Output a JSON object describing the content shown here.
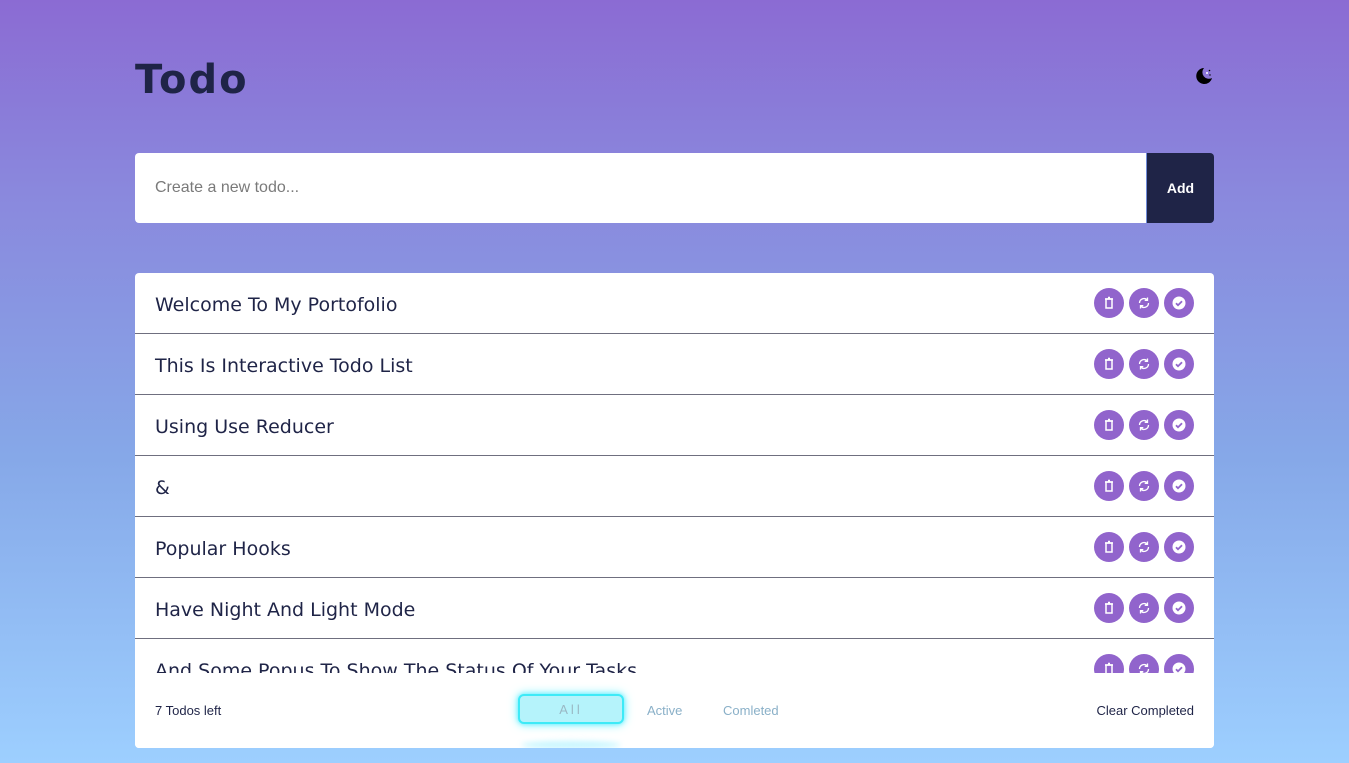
{
  "header": {
    "title": "Todo",
    "theme_icon": "moon-icon"
  },
  "new_todo": {
    "placeholder": "Create a new todo...",
    "value": "",
    "add_label": "Add"
  },
  "todos": [
    {
      "text": "Welcome To My Portofolio"
    },
    {
      "text": "This Is Interactive Todo List"
    },
    {
      "text": "Using Use Reducer"
    },
    {
      "text": "&"
    },
    {
      "text": "Popular Hooks"
    },
    {
      "text": "Have Night And Light Mode"
    },
    {
      "text": "And Some Popus To Show The Status Of Your Tasks"
    }
  ],
  "item_actions": [
    "trash-icon",
    "refresh-icon",
    "check-circle-icon"
  ],
  "footer": {
    "count": "7 Todos left",
    "filters": {
      "all": "All",
      "active": "Active",
      "completed": "Comleted"
    },
    "clear": "Clear Completed"
  },
  "colors": {
    "primary_dark": "#1f2447",
    "action_purple": "#9164cc",
    "filter_glow": "#3eeaf7"
  }
}
